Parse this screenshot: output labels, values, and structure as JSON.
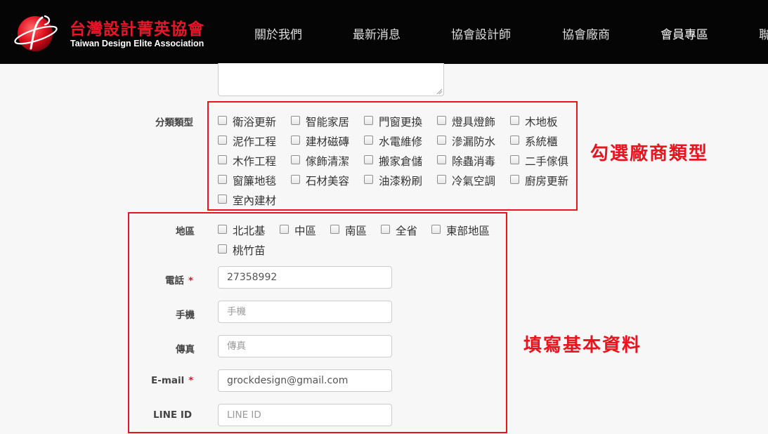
{
  "header": {
    "logo_title": "台灣設計菁英協會",
    "logo_subtitle": "Taiwan Design Elite Association",
    "nav": [
      "關於我們",
      "最新消息",
      "協會設計師",
      "協會廠商",
      "會員專區",
      "聯"
    ]
  },
  "form": {
    "category": {
      "label": "分類類型",
      "options": [
        "衛浴更新",
        "智能家居",
        "門窗更換",
        "燈具燈飾",
        "木地板",
        "泥作工程",
        "建材磁磚",
        "水電維修",
        "滲漏防水",
        "系統櫃",
        "木作工程",
        "傢飾清潔",
        "搬家倉儲",
        "除蟲消毒",
        "二手傢俱",
        "窗簾地毯",
        "石材美容",
        "油漆粉刷",
        "冷氣空調",
        "廚房更新",
        "室內建材"
      ]
    },
    "region": {
      "label": "地區",
      "options": [
        "北北基",
        "中區",
        "南區",
        "全省",
        "東部地區",
        "桃竹苗"
      ]
    },
    "phone": {
      "label": "電話",
      "required_mark": "*",
      "value": "27358992"
    },
    "mobile": {
      "label": "手機",
      "placeholder": "手機"
    },
    "fax": {
      "label": "傳真",
      "placeholder": "傳真"
    },
    "email": {
      "label": "E-mail",
      "required_mark": "*",
      "value": "grockdesign@gmail.com"
    },
    "line": {
      "label": "LINE ID",
      "placeholder": "LINE ID"
    }
  },
  "annotations": {
    "category_note": "勾選廠商類型",
    "basic_note": "填寫基本資料",
    "color": "#e8141e"
  }
}
